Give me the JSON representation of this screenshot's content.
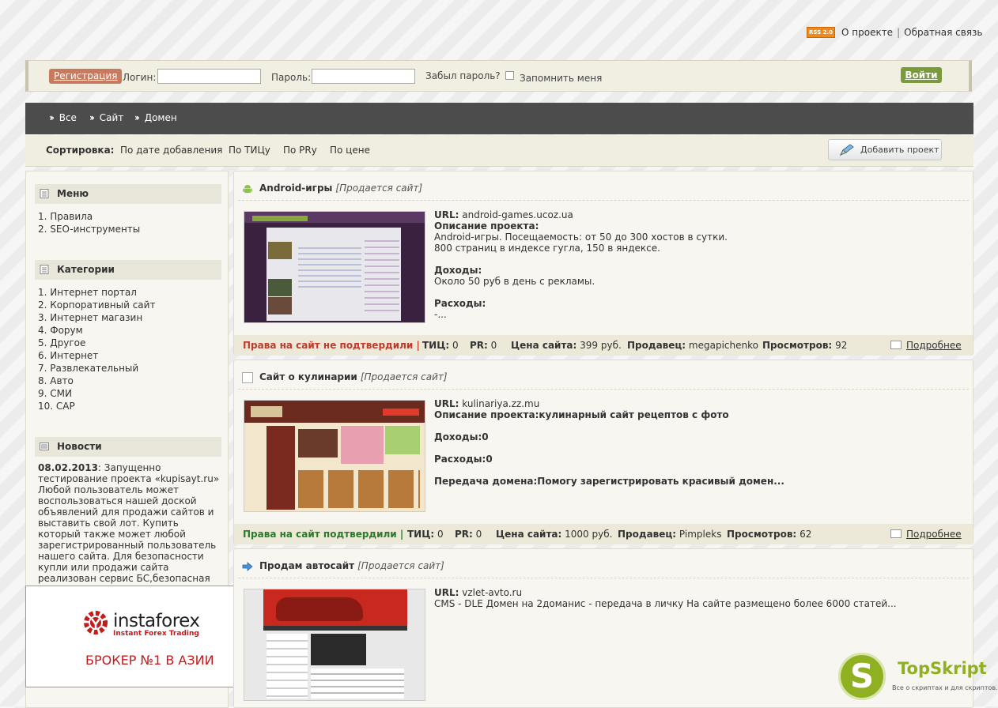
{
  "top_links": {
    "rss": "RSS 2.0",
    "about": "О проекте",
    "sep": "|",
    "feedback": "Обратная связь"
  },
  "login": {
    "register": "Регистрация",
    "login_label": "Логин:",
    "password_label": "Пароль:",
    "forgot": "Забыл пароль?",
    "remember": "Запомнить меня",
    "submit": "Войти"
  },
  "nav": {
    "items": [
      "Все",
      "Сайт",
      "Домен"
    ]
  },
  "sort": {
    "label": "Сортировка:",
    "options": [
      "По дате добавления",
      "По ТИЦу",
      "По PRу",
      "По цене"
    ],
    "add_project": "Добавить проект"
  },
  "sidebar": {
    "menu": {
      "title": "Меню",
      "items": [
        "1. Правила",
        "2. SEO-инструменты"
      ]
    },
    "categories": {
      "title": "Категории",
      "items": [
        "1. Интернет портал",
        "2. Корпоративный сайт",
        "3. Интернет магазин",
        "4. Форум",
        "5. Другое",
        "6. Интернет",
        "7. Развлекательный",
        "8. Авто",
        "9. СМИ",
        "10. САР"
      ]
    },
    "news": {
      "title": "Новости",
      "date": "08.02.2013",
      "text": ": Запущенно тестирование проекта «kupisayt.ru» Любой пользователь может воспользоваться нашей доской объявлений для продажи сайтов и выставить свой лот. Купить который также может любой зарегистрированный пользователь нашего сайта. Для безопасности купли или продажи сайта реализован сервис БС,безопасная сделка."
    },
    "ad": {
      "brand": "instaforex",
      "sub": "Instant Forex Trading",
      "slogan": "БРОКЕР №1 В АЗИИ"
    }
  },
  "listings": [
    {
      "title": "Android-игры",
      "status": "[Продается сайт]",
      "url_label": "URL:",
      "url": "android-games.ucoz.ua",
      "desc_label": "Описание проекта:",
      "desc": "Android-игры. Посещаемость: от 50 до 300 хостов в сутки.",
      "desc2": "800 страниц в индексе гугла, 150 в яндексе.",
      "income_label": "Доходы:",
      "income": "Около 50 руб в день с рекламы.",
      "expense_label": "Расходы:",
      "expense": "-...",
      "rights": "Права на сайт не подтвердили |",
      "tic_label": "ТИЦ:",
      "tic": "0",
      "pr_label": "PR:",
      "pr": "0",
      "price_label": "Цена сайта:",
      "price": "399 руб.",
      "seller_label": "Продавец:",
      "seller": "megapichenko",
      "views_label": "Просмотров:",
      "views": "92",
      "more": "Подробнее"
    },
    {
      "title": "Сайт о кулинарии",
      "status": "[Продается сайт]",
      "url_label": "URL:",
      "url": "kulinariya.zz.mu",
      "desc_full": "Описание проекта:кулинарный сайт рецептов с фото",
      "income_full": "Доходы:0",
      "expense_full": "Расходы:0",
      "domain_full": "Передача домена:Помогу зарегистрировать красивый домен...",
      "rights": "Права на сайт подтвердили |",
      "tic_label": "ТИЦ:",
      "tic": "0",
      "pr_label": "PR:",
      "pr": "0",
      "price_label": "Цена сайта:",
      "price": "1000 руб.",
      "seller_label": "Продавец:",
      "seller": "Pimpleks",
      "views_label": "Просмотров:",
      "views": "62",
      "more": "Подробнее"
    },
    {
      "title": "Продам автосайт",
      "status": "[Продается сайт]",
      "url_label": "URL:",
      "url": "vzlet-avto.ru",
      "desc": "CMS - DLE Домен на 2доманис - передача в личку На сайте размещено более 6000 статей..."
    }
  ],
  "watermark": {
    "letter": "S",
    "name": "TopSkript",
    "tag": "Все о скриптах и для скриптов..."
  },
  "colors": {
    "nav_bg": "#4c4c4c",
    "accent_green": "#7a9b3a",
    "register_bg": "#c77a5e",
    "rights_red": "#c0392b",
    "rights_green": "#2a7a2a"
  }
}
